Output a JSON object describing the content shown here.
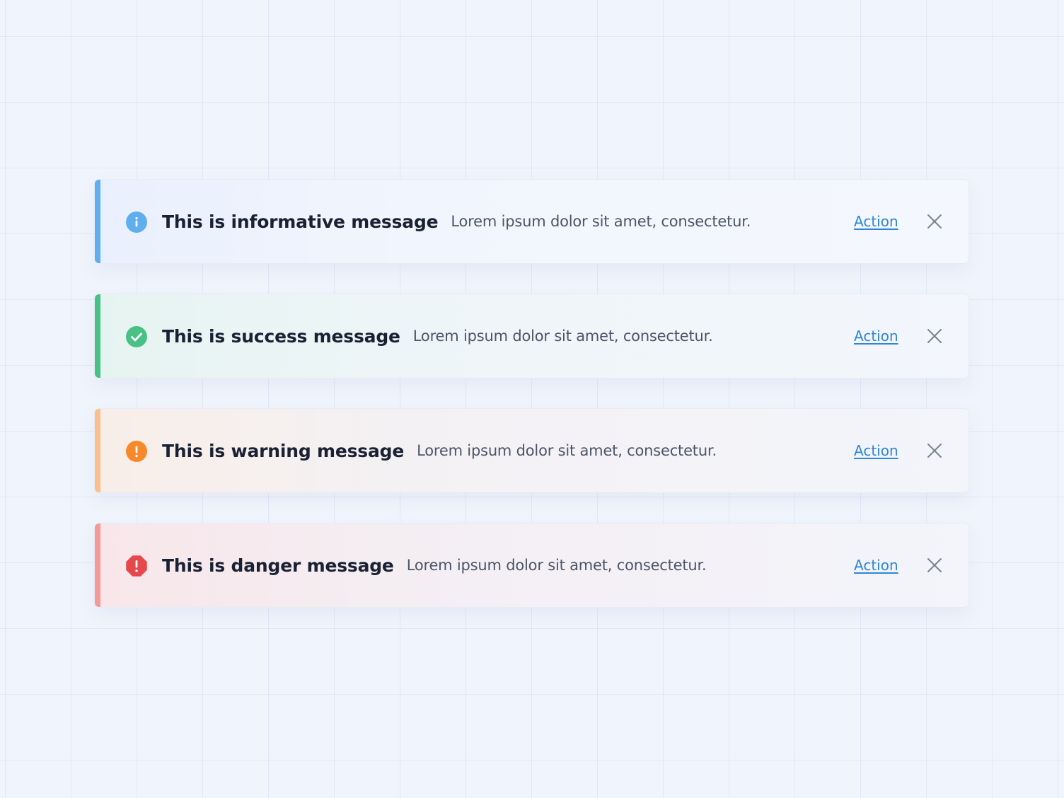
{
  "alerts": [
    {
      "type": "info",
      "icon": "info-icon",
      "accent": "#5faeee",
      "title": "This is informative message",
      "description": "Lorem ipsum dolor sit amet, consectetur.",
      "action_label": "Action"
    },
    {
      "type": "success",
      "icon": "check-circle-icon",
      "accent": "#49c085",
      "title": "This is success message",
      "description": "Lorem ipsum dolor sit amet, consectetur.",
      "action_label": "Action"
    },
    {
      "type": "warning",
      "icon": "exclamation-circle-icon",
      "accent": "#fbbf8c",
      "title": "This is warning message",
      "description": "Lorem ipsum dolor sit amet, consectetur.",
      "action_label": "Action"
    },
    {
      "type": "danger",
      "icon": "exclamation-octagon-icon",
      "accent": "#f59898",
      "title": "This is danger message",
      "description": "Lorem ipsum dolor sit amet, consectetur.",
      "action_label": "Action"
    }
  ],
  "colors": {
    "link": "#2f86d6",
    "close_icon": "#7a8291",
    "info_icon": "#5faeee",
    "success_icon": "#49c085",
    "warning_icon": "#f7892a",
    "danger_icon": "#e5484d"
  }
}
